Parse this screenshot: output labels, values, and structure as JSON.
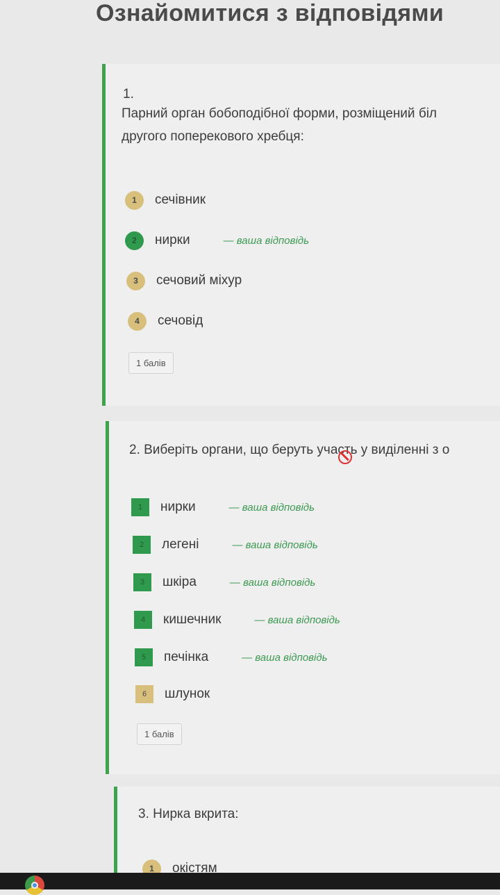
{
  "page": {
    "title": "Ознайомитися з відповідями"
  },
  "q1": {
    "number": "1.",
    "text_line1": "Парний орган бобоподібної форми, розміщений біл",
    "text_line2": "другого поперекового хребця:",
    "options": [
      {
        "num": "1",
        "label": "сечівник",
        "status": "neutral"
      },
      {
        "num": "2",
        "label": "нирки",
        "status": "correct",
        "note": "— ваша відповідь"
      },
      {
        "num": "3",
        "label": "сечовий міхур",
        "status": "neutral"
      },
      {
        "num": "4",
        "label": "сечовід",
        "status": "neutral"
      }
    ],
    "points": "1 балів"
  },
  "q2": {
    "text": "2. Виберіть органи, що беруть участь у виділенні з о",
    "options": [
      {
        "num": "1",
        "label": "нирки",
        "status": "correct",
        "note": "— ваша відповідь"
      },
      {
        "num": "2",
        "label": "легені",
        "status": "correct",
        "note": "— ваша відповідь"
      },
      {
        "num": "3",
        "label": "шкіра",
        "status": "correct",
        "note": "— ваша відповідь"
      },
      {
        "num": "4",
        "label": "кишечник",
        "status": "correct",
        "note": "— ваша відповідь"
      },
      {
        "num": "5",
        "label": "печінка",
        "status": "correct",
        "note": "— ваша відповідь"
      },
      {
        "num": "6",
        "label": "шлунок",
        "status": "neutral"
      }
    ],
    "points": "1 балів"
  },
  "q3": {
    "text": "3. Нирка вкрита:",
    "options": [
      {
        "num": "1",
        "label": "окістям",
        "status": "neutral"
      }
    ]
  },
  "icons": {
    "cursor": "not-allowed-cursor-icon",
    "taskbar": "chrome-icon"
  },
  "colors": {
    "accent": "#3fa34d",
    "correct": "#2f9a4e",
    "neutral": "#d8c07c"
  }
}
